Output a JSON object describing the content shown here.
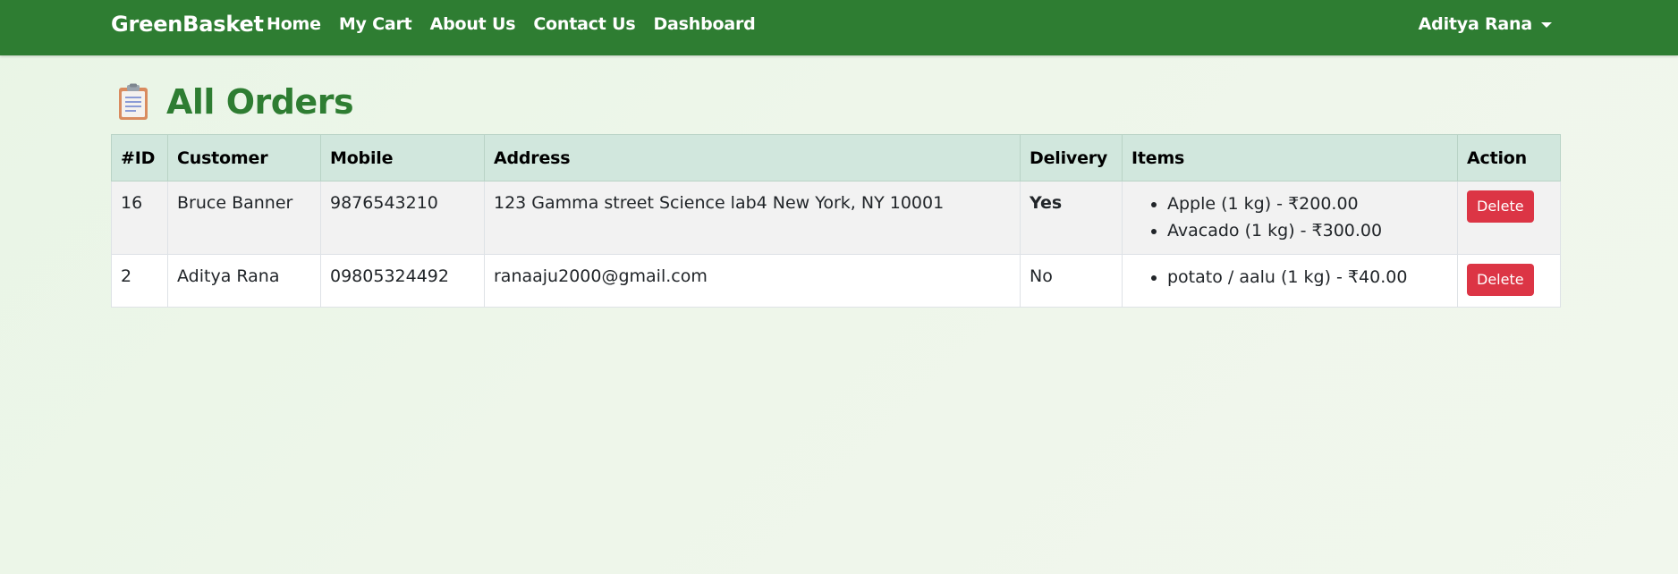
{
  "navbar": {
    "brand": "GreenBasket",
    "links": [
      "Home",
      "My Cart",
      "About Us",
      "Contact Us",
      "Dashboard"
    ],
    "user_name": "Aditya Rana",
    "caret_icon": "caret-down-icon"
  },
  "page": {
    "title": "All Orders",
    "title_icon": "clipboard-icon"
  },
  "colors": {
    "navbar": "#2e7d32",
    "title": "#2e7d32",
    "table_header_bg": "#d1e7dd",
    "delivery_yes": "#e00000",
    "delete_button": "#dc3545"
  },
  "orders_table": {
    "headers": [
      "#ID",
      "Customer",
      "Mobile",
      "Address",
      "Delivery",
      "Items",
      "Action"
    ],
    "rows": [
      {
        "id": "16",
        "customer": "Bruce Banner",
        "mobile": "9876543210",
        "address": "123 Gamma street Science lab4 New York, NY 10001",
        "delivery": "Yes",
        "items": [
          "Apple (1 kg) - ₹200.00",
          "Avacado (1 kg) - ₹300.00"
        ],
        "action": "Delete"
      },
      {
        "id": "2",
        "customer": "Aditya Rana",
        "mobile": "09805324492",
        "address": "ranaaju2000@gmail.com",
        "delivery": "No",
        "items": [
          "potato / aalu (1 kg) - ₹40.00"
        ],
        "action": "Delete"
      }
    ]
  }
}
